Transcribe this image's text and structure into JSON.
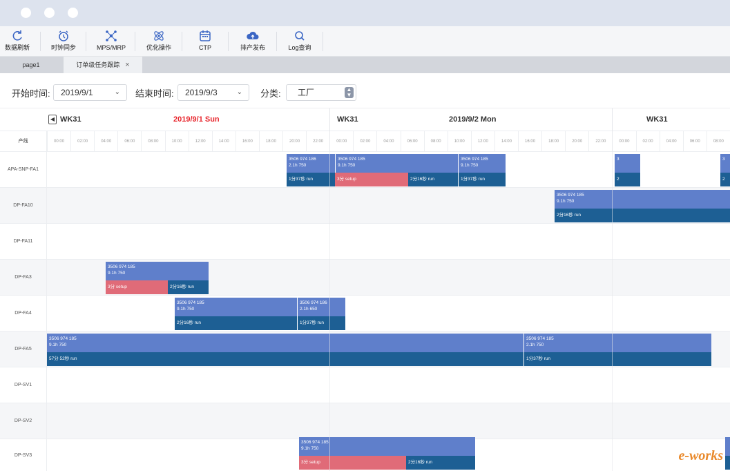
{
  "toolbar": {
    "items": [
      {
        "label": "数据刷新",
        "icon": "refresh-icon"
      },
      {
        "label": "时钟同步",
        "icon": "alarm-clock-icon"
      },
      {
        "label": "MPS/MRP",
        "icon": "network-icon"
      },
      {
        "label": "优化操作",
        "icon": "atom-icon"
      },
      {
        "label": "CTP",
        "icon": "calendar-icon"
      },
      {
        "label": "排产发布",
        "icon": "cloud-upload-icon"
      },
      {
        "label": "Log查询",
        "icon": "search-icon"
      }
    ]
  },
  "tabs": [
    {
      "label": "page1"
    },
    {
      "label": "订单级任务跟踪",
      "close": "×"
    }
  ],
  "filters": {
    "start_label": "开始时间:",
    "start_value": "2019/9/1",
    "end_label": "结束时间:",
    "end_value": "2019/9/3",
    "category_label": "分类:",
    "category_value": "工厂"
  },
  "gantt": {
    "line_header": "产线",
    "weeks": [
      "WK31",
      "WK31",
      "WK31"
    ],
    "days": [
      {
        "label": "2019/9/1 Sun",
        "highlight": true
      },
      {
        "label": "2019/9/2 Mon",
        "highlight": false
      }
    ],
    "hours": [
      "00:00",
      "02:00",
      "04:00",
      "06:00",
      "08:00",
      "10:00",
      "12:00",
      "14:00",
      "16:00",
      "18:00",
      "20:00",
      "22:00",
      "00:00",
      "02:00",
      "04:00",
      "06:00",
      "08:00",
      "10:00",
      "12:00",
      "14:00",
      "16:00",
      "18:00",
      "20:00",
      "22:00",
      "00:00",
      "02:00",
      "04:00",
      "06:00",
      "08:00"
    ],
    "rows": [
      {
        "name": "APA-SNP-FA1"
      },
      {
        "name": "DP-FA10"
      },
      {
        "name": "DP-FA11"
      },
      {
        "name": "DP-FA3"
      },
      {
        "name": "DP-FA4"
      },
      {
        "name": "DP-FA5"
      },
      {
        "name": "DP-SV1"
      },
      {
        "name": "DP-SV2"
      },
      {
        "name": "DP-SV3"
      }
    ],
    "tasks": {
      "fa1_a": {
        "order": "3506 974 186",
        "qty": "2.1h    750",
        "run": "1分37秒 run"
      },
      "fa1_b": {
        "order": "3506 974 185",
        "qty": "9.1h    750",
        "setup": "3分 setup",
        "run": "2分16秒 run"
      },
      "fa1_c": {
        "order": "3506 974 185",
        "qty": "9.1h    750",
        "run": "1分37秒 run"
      },
      "fa1_d": {
        "order": "3",
        "run": "2"
      },
      "fa1_e": {
        "order": "3",
        "run": "2"
      },
      "fa10": {
        "order": "3506 974 185",
        "qty": "9.1h    750",
        "run": "2分16秒 run"
      },
      "fa3": {
        "order": "3506 974 185",
        "qty": "9.1h    750",
        "setup": "3分 setup",
        "run": "2分16秒 run"
      },
      "fa4_a": {
        "order": "3506 974 185",
        "qty": "9.1h    750",
        "run": "2分16秒 run"
      },
      "fa4_b": {
        "order": "3506 974 186",
        "qty": "2.1h    650",
        "run": "1分37秒 run"
      },
      "fa5_a": {
        "order": "3506 974 185",
        "qty": "9.1h    750",
        "run": "57分 52秒 run"
      },
      "fa5_b": {
        "order": "3506 974 185",
        "qty": "2.1h    750",
        "run": "1分37秒 run"
      },
      "sv3": {
        "order": "3506 974 185",
        "qty": "9.1h    750",
        "setup": "3分 setup",
        "run": "2分16秒 run"
      }
    }
  },
  "watermark": "e-works",
  "colors": {
    "bar_light": "#5f7fcb",
    "bar_run": "#1d5f94",
    "bar_setup": "#e06b78",
    "today_red": "#e8262d"
  }
}
